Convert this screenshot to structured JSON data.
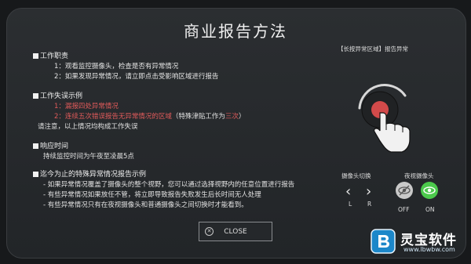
{
  "title": "商业报告方法",
  "sections": {
    "duties": {
      "heading": "工作职责",
      "items": [
        "1：观看监控摄像头，检查是否有异常情况",
        "2：如果发现异常情况，请立即点击受影响区域进行报告"
      ]
    },
    "failures": {
      "heading": "工作失误示例",
      "items": [
        "1：漏报四处异常情况",
        "2：连续五次错误报告无异常情况的区域"
      ],
      "note": "（特殊津贴工作为",
      "note_highlight": "三次",
      "note_end": "）",
      "summary": "请注意，以上情况均构成工作失误"
    },
    "response": {
      "heading": "响应时间",
      "text": "持续监控时间为午夜至凌晨5点"
    },
    "examples": {
      "heading": "迄今为止的特殊异常情况报告示例",
      "items": [
        "- 如果异常情况覆盖了摄像头的整个视野，您可以通过选择视野内的任意位置进行报告",
        "- 有些异常情况如果放任不管，将立即导致报告失败发生后长时间无人处理",
        "- 有些异常情况只有在夜视摄像头和普通摄像头之间切换时才能看到。"
      ]
    }
  },
  "hint": {
    "label_bracket": "【长按异常区域】",
    "label_text": "报告异常"
  },
  "camera_switch": {
    "label": "摄像头切换",
    "left": "L",
    "right": "R"
  },
  "night_vision": {
    "label": "夜视摄像头",
    "off": "OFF",
    "on": "ON"
  },
  "close_button": {
    "label": "CLOSE"
  },
  "brand": {
    "name": "灵宝软件",
    "url": "www.lbwbw.com"
  },
  "colors": {
    "accent_red": "#e05a5a",
    "night_on": "#4cc94c"
  }
}
